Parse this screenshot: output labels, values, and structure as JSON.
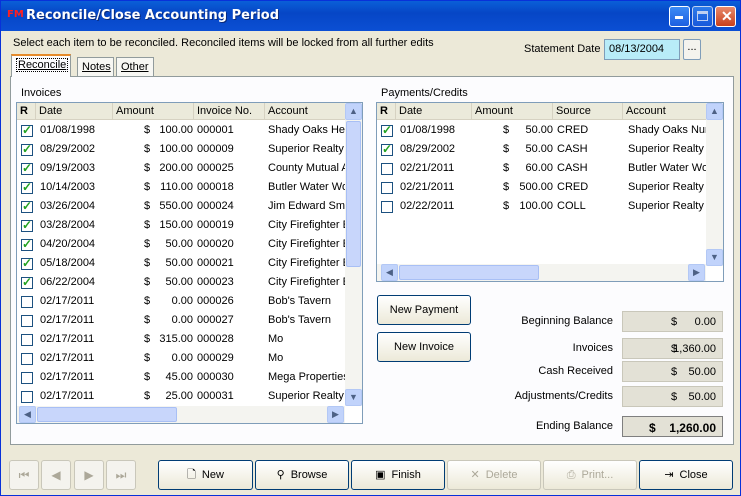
{
  "window": {
    "title": "Reconcile/Close Accounting Period",
    "app_icon": "FM"
  },
  "instructions": "Select each item to be reconciled.  Reconciled items will be locked from all further edits",
  "statement": {
    "label": "Statement Date",
    "value": "08/13/2004",
    "button": "..."
  },
  "tabs": [
    {
      "label": "Reconcile"
    },
    {
      "label": "Notes"
    },
    {
      "label": "Other"
    }
  ],
  "invoices": {
    "title": "Invoices",
    "columns": [
      "R",
      "Date",
      "Amount",
      "Invoice No.",
      "Account"
    ],
    "rows": [
      {
        "checked": true,
        "date": "01/08/1998",
        "cur": "$",
        "amount": "100.00",
        "no": "000001",
        "account": "Shady Oaks Hea"
      },
      {
        "checked": true,
        "date": "08/29/2002",
        "cur": "$",
        "amount": "100.00",
        "no": "000009",
        "account": "Superior Realty I"
      },
      {
        "checked": true,
        "date": "09/19/2003",
        "cur": "$",
        "amount": "200.00",
        "no": "000025",
        "account": "County Mutual A"
      },
      {
        "checked": true,
        "date": "10/14/2003",
        "cur": "$",
        "amount": "110.00",
        "no": "000018",
        "account": "Butler Water Wo"
      },
      {
        "checked": true,
        "date": "03/26/2004",
        "cur": "$",
        "amount": "550.00",
        "no": "000024",
        "account": "Jim Edward Smit"
      },
      {
        "checked": true,
        "date": "03/28/2004",
        "cur": "$",
        "amount": "150.00",
        "no": "000019",
        "account": "City Firefighter E"
      },
      {
        "checked": true,
        "date": "04/20/2004",
        "cur": "$",
        "amount": "50.00",
        "no": "000020",
        "account": "City Firefighter E"
      },
      {
        "checked": true,
        "date": "05/18/2004",
        "cur": "$",
        "amount": "50.00",
        "no": "000021",
        "account": "City Firefighter E"
      },
      {
        "checked": true,
        "date": "06/22/2004",
        "cur": "$",
        "amount": "50.00",
        "no": "000023",
        "account": "City Firefighter E"
      },
      {
        "checked": false,
        "date": "02/17/2011",
        "cur": "$",
        "amount": "0.00",
        "no": "000026",
        "account": "Bob's Tavern"
      },
      {
        "checked": false,
        "date": "02/17/2011",
        "cur": "$",
        "amount": "0.00",
        "no": "000027",
        "account": "Bob's Tavern"
      },
      {
        "checked": false,
        "date": "02/17/2011",
        "cur": "$",
        "amount": "315.00",
        "no": "000028",
        "account": "Mo"
      },
      {
        "checked": false,
        "date": "02/17/2011",
        "cur": "$",
        "amount": "0.00",
        "no": "000029",
        "account": "Mo"
      },
      {
        "checked": false,
        "date": "02/17/2011",
        "cur": "$",
        "amount": "45.00",
        "no": "000030",
        "account": "Mega Properties"
      },
      {
        "checked": false,
        "date": "02/17/2011",
        "cur": "$",
        "amount": "25.00",
        "no": "000031",
        "account": "Superior Realty I"
      }
    ]
  },
  "payments": {
    "title": "Payments/Credits",
    "columns": [
      "R",
      "Date",
      "Amount",
      "Source",
      "Account"
    ],
    "rows": [
      {
        "checked": true,
        "date": "01/08/1998",
        "cur": "$",
        "amount": "50.00",
        "source": "CRED",
        "account": "Shady Oaks Nur"
      },
      {
        "checked": true,
        "date": "08/29/2002",
        "cur": "$",
        "amount": "50.00",
        "source": "CASH",
        "account": "Superior Realty I"
      },
      {
        "checked": false,
        "date": "02/21/2011",
        "cur": "$",
        "amount": "60.00",
        "source": "CASH",
        "account": "Butler Water Wo"
      },
      {
        "checked": false,
        "date": "02/21/2011",
        "cur": "$",
        "amount": "500.00",
        "source": "CRED",
        "account": "Superior Realty I"
      },
      {
        "checked": false,
        "date": "02/22/2011",
        "cur": "$",
        "amount": "100.00",
        "source": "COLL",
        "account": "Superior Realty I"
      }
    ]
  },
  "actions": {
    "new_payment": "New Payment",
    "new_invoice": "New Invoice"
  },
  "summary": [
    {
      "label": "Beginning Balance",
      "cur": "$",
      "value": "0.00"
    },
    {
      "label": "Invoices",
      "cur": "$",
      "value": "1,360.00"
    },
    {
      "label": "Cash Received",
      "cur": "$",
      "value": "50.00"
    },
    {
      "label": "Adjustments/Credits",
      "cur": "$",
      "value": "50.00"
    }
  ],
  "ending": {
    "label": "Ending Balance",
    "cur": "$",
    "value": "1,260.00"
  },
  "toolbar": {
    "new": "New",
    "browse": "Browse",
    "finish": "Finish",
    "delete": "Delete",
    "print": "Print...",
    "close": "Close"
  },
  "colors": {
    "title_bar": "#0a5fd8",
    "statement_field": "#b8ecf8",
    "check": "#21a121"
  }
}
